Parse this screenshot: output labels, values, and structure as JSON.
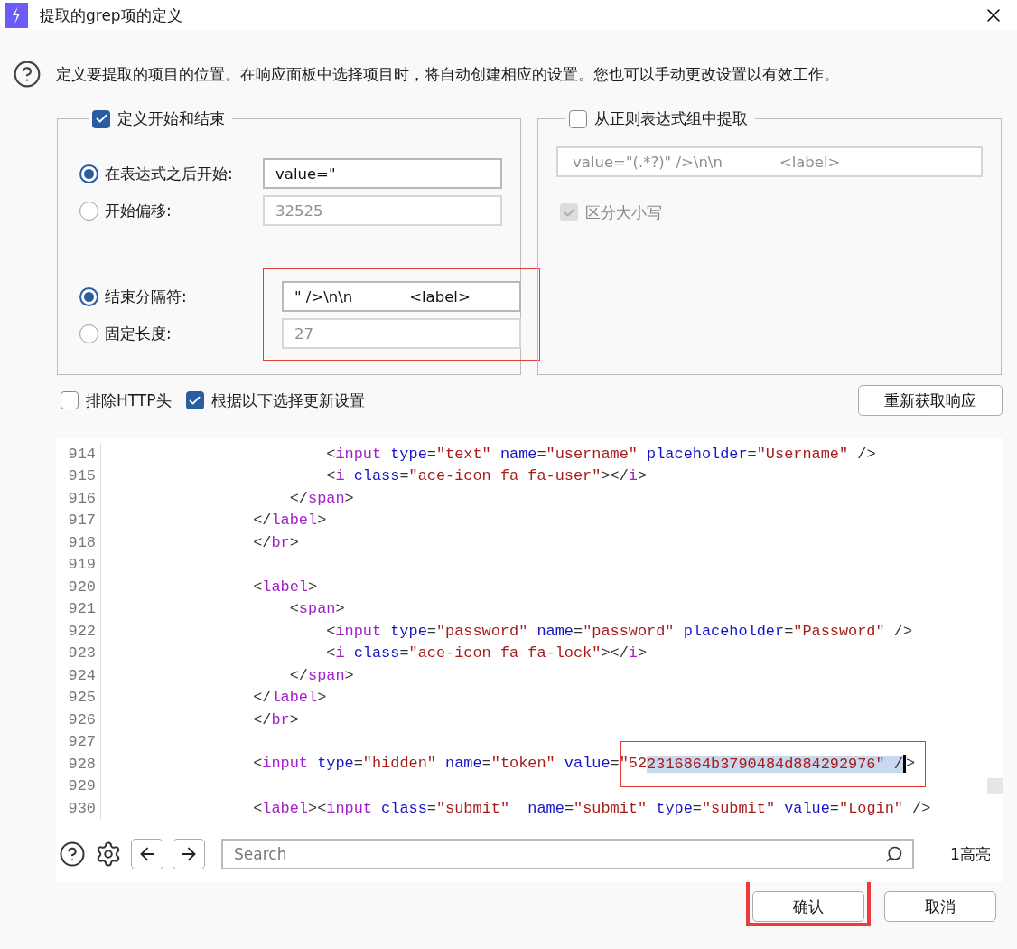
{
  "window": {
    "title": "提取的grep项的定义"
  },
  "intro": "定义要提取的项目的位置。在响应面板中选择项目时，将自动创建相应的设置。您也可以手动更改设置以有效工作。",
  "start_end": {
    "label": "定义开始和结束",
    "checked": true,
    "end_highlighted": true,
    "start_options": [
      {
        "label": "在表达式之后开始:",
        "selected": true,
        "value": "value=\""
      },
      {
        "label": "开始偏移:",
        "selected": false,
        "value": "32525"
      }
    ],
    "end_options": [
      {
        "label": "结束分隔符:",
        "selected": true,
        "value": "\" />\\n\\n            <label>"
      },
      {
        "label": "固定长度:",
        "selected": false,
        "value": "27"
      }
    ]
  },
  "regex_group": {
    "label": "从正则表达式组中提取",
    "checked": false,
    "expression": "value=\"(.*?)\" />\\n\\n            <label>",
    "case_sensitive": {
      "label": "区分大小写",
      "checked": true
    }
  },
  "options": [
    {
      "label": "排除HTTP头",
      "checked": false
    },
    {
      "label": "根据以下选择更新设置",
      "checked": true
    }
  ],
  "refetch_button": "重新获取响应",
  "editor": {
    "lines": [
      {
        "number": "914",
        "tokens": [
          {
            "kind": "punct",
            "text": "                        <"
          },
          {
            "kind": "tag",
            "text": "input"
          },
          {
            "kind": "attr",
            "text": " type"
          },
          {
            "kind": "punct",
            "text": "="
          },
          {
            "kind": "str",
            "text": "\"text\""
          },
          {
            "kind": "attr",
            "text": " name"
          },
          {
            "kind": "punct",
            "text": "="
          },
          {
            "kind": "str",
            "text": "\"username\""
          },
          {
            "kind": "attr",
            "text": " placeholder"
          },
          {
            "kind": "punct",
            "text": "="
          },
          {
            "kind": "str",
            "text": "\"Username\""
          },
          {
            "kind": "punct",
            "text": " />"
          }
        ]
      },
      {
        "number": "915",
        "tokens": [
          {
            "kind": "punct",
            "text": "                        <"
          },
          {
            "kind": "tag",
            "text": "i"
          },
          {
            "kind": "attr",
            "text": " class"
          },
          {
            "kind": "punct",
            "text": "="
          },
          {
            "kind": "str",
            "text": "\"ace-icon fa fa-user\""
          },
          {
            "kind": "punct",
            "text": "></"
          },
          {
            "kind": "tag",
            "text": "i"
          },
          {
            "kind": "punct",
            "text": ">"
          }
        ]
      },
      {
        "number": "916",
        "tokens": [
          {
            "kind": "punct",
            "text": "                    </"
          },
          {
            "kind": "tag",
            "text": "span"
          },
          {
            "kind": "punct",
            "text": ">"
          }
        ]
      },
      {
        "number": "917",
        "tokens": [
          {
            "kind": "punct",
            "text": "                </"
          },
          {
            "kind": "tag",
            "text": "label"
          },
          {
            "kind": "punct",
            "text": ">"
          }
        ]
      },
      {
        "number": "918",
        "tokens": [
          {
            "kind": "punct",
            "text": "                </"
          },
          {
            "kind": "tag",
            "text": "br"
          },
          {
            "kind": "punct",
            "text": ">"
          }
        ]
      },
      {
        "number": "919"
      },
      {
        "number": "920",
        "tokens": [
          {
            "kind": "punct",
            "text": "                <"
          },
          {
            "kind": "tag",
            "text": "label"
          },
          {
            "kind": "punct",
            "text": ">"
          }
        ]
      },
      {
        "number": "921",
        "tokens": [
          {
            "kind": "punct",
            "text": "                    <"
          },
          {
            "kind": "tag",
            "text": "span"
          },
          {
            "kind": "punct",
            "text": ">"
          }
        ]
      },
      {
        "number": "922",
        "tokens": [
          {
            "kind": "punct",
            "text": "                        <"
          },
          {
            "kind": "tag",
            "text": "input"
          },
          {
            "kind": "attr",
            "text": " type"
          },
          {
            "kind": "punct",
            "text": "="
          },
          {
            "kind": "str",
            "text": "\"password\""
          },
          {
            "kind": "attr",
            "text": " name"
          },
          {
            "kind": "punct",
            "text": "="
          },
          {
            "kind": "str",
            "text": "\"password\""
          },
          {
            "kind": "attr",
            "text": " placeholder"
          },
          {
            "kind": "punct",
            "text": "="
          },
          {
            "kind": "str",
            "text": "\"Password\""
          },
          {
            "kind": "punct",
            "text": " />"
          }
        ]
      },
      {
        "number": "923",
        "tokens": [
          {
            "kind": "punct",
            "text": "                        <"
          },
          {
            "kind": "tag",
            "text": "i"
          },
          {
            "kind": "attr",
            "text": " class"
          },
          {
            "kind": "punct",
            "text": "="
          },
          {
            "kind": "str",
            "text": "\"ace-icon fa fa-lock\""
          },
          {
            "kind": "punct",
            "text": "></"
          },
          {
            "kind": "tag",
            "text": "i"
          },
          {
            "kind": "punct",
            "text": ">"
          }
        ]
      },
      {
        "number": "924",
        "tokens": [
          {
            "kind": "punct",
            "text": "                    </"
          },
          {
            "kind": "tag",
            "text": "span"
          },
          {
            "kind": "punct",
            "text": ">"
          }
        ]
      },
      {
        "number": "925",
        "tokens": [
          {
            "kind": "punct",
            "text": "                </"
          },
          {
            "kind": "tag",
            "text": "label"
          },
          {
            "kind": "punct",
            "text": ">"
          }
        ]
      },
      {
        "number": "926",
        "tokens": [
          {
            "kind": "punct",
            "text": "                </"
          },
          {
            "kind": "tag",
            "text": "br"
          },
          {
            "kind": "punct",
            "text": ">"
          }
        ]
      },
      {
        "number": "927"
      },
      {
        "number": "928",
        "highlighted": true,
        "tokens": [
          {
            "kind": "punct",
            "text": "                <",
            "selected": false
          },
          {
            "kind": "tag",
            "text": "input",
            "selected": false
          },
          {
            "kind": "attr",
            "text": " type",
            "selected": false
          },
          {
            "kind": "punct",
            "text": "=",
            "selected": false
          },
          {
            "kind": "str",
            "text": "\"hidden\"",
            "selected": false
          },
          {
            "kind": "attr",
            "text": " name",
            "selected": false
          },
          {
            "kind": "punct",
            "text": "=",
            "selected": false
          },
          {
            "kind": "str",
            "text": "\"token\"",
            "selected": false
          },
          {
            "kind": "attr",
            "text": " value",
            "selected": false
          },
          {
            "kind": "punct",
            "text": "=",
            "selected": false
          },
          {
            "kind": "str",
            "text": "\"52",
            "selected": false
          },
          {
            "kind": "str",
            "text": "2316864b3790484d884292976\"",
            "selected": true
          },
          {
            "kind": "punct",
            "text": " /",
            "selected": true
          },
          {
            "kind": "punct",
            "text": ">",
            "selected": false
          }
        ]
      },
      {
        "number": "929"
      },
      {
        "number": "930",
        "tokens": [
          {
            "kind": "punct",
            "text": "                <"
          },
          {
            "kind": "tag",
            "text": "label"
          },
          {
            "kind": "punct",
            "text": "><"
          },
          {
            "kind": "tag",
            "text": "input"
          },
          {
            "kind": "attr",
            "text": " class"
          },
          {
            "kind": "punct",
            "text": "="
          },
          {
            "kind": "str",
            "text": "\"submit\""
          },
          {
            "kind": "attr",
            "text": "  name"
          },
          {
            "kind": "punct",
            "text": "="
          },
          {
            "kind": "str",
            "text": "\"submit\""
          },
          {
            "kind": "attr",
            "text": " type"
          },
          {
            "kind": "punct",
            "text": "="
          },
          {
            "kind": "str",
            "text": "\"submit\""
          },
          {
            "kind": "attr",
            "text": " value"
          },
          {
            "kind": "punct",
            "text": "="
          },
          {
            "kind": "str",
            "text": "\"Login\""
          },
          {
            "kind": "punct",
            "text": " />"
          }
        ]
      }
    ],
    "search": {
      "placeholder": "Search"
    },
    "match_count": "1高亮"
  },
  "buttons": [
    {
      "label": "确认",
      "highlighted": true
    },
    {
      "label": "取消",
      "highlighted": false
    }
  ]
}
